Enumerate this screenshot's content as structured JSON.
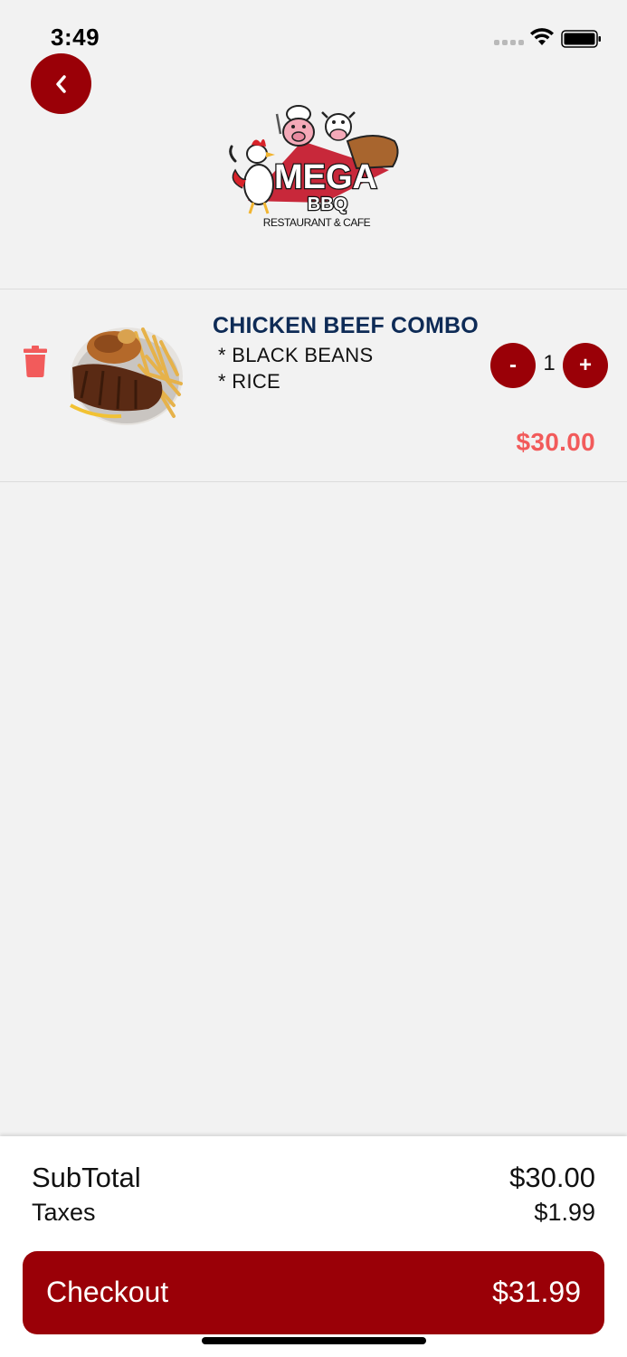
{
  "status_bar": {
    "time": "3:49"
  },
  "header": {
    "logo_name": "MEGA",
    "logo_sub": "BBQ",
    "logo_tagline": "RESTAURANT & CAFE"
  },
  "cart": {
    "item": {
      "name": "CHICKEN BEEF COMBO",
      "options": [
        "* BLACK BEANS",
        "* RICE"
      ],
      "quantity": "1",
      "minus_label": "-",
      "plus_label": "+",
      "price": "$30.00"
    }
  },
  "summary": {
    "subtotal_label": "SubTotal",
    "subtotal_value": "$30.00",
    "taxes_label": "Taxes",
    "taxes_value": "$1.99",
    "checkout_label": "Checkout",
    "checkout_total": "$31.99"
  },
  "colors": {
    "accent": "#9a0007",
    "price": "#f25b5b",
    "item_title": "#0e2b56",
    "background": "#f2f2f2"
  },
  "icons": [
    "chevron-left-icon",
    "trash-icon",
    "wifi-icon",
    "battery-icon",
    "signal-icon"
  ]
}
